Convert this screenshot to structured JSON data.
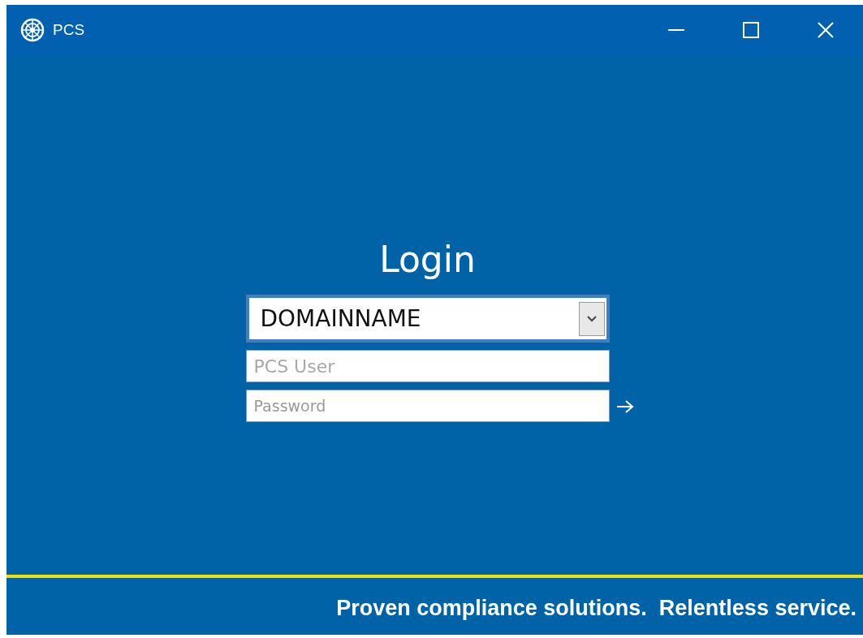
{
  "window": {
    "title": "PCS"
  },
  "login": {
    "heading": "Login",
    "domain": {
      "value": "DOMAINNAME"
    },
    "user": {
      "placeholder": "PCS User"
    },
    "password": {
      "placeholder": "Password"
    }
  },
  "footer": {
    "tagline": "Proven compliance solutions.  Relentless service."
  }
}
